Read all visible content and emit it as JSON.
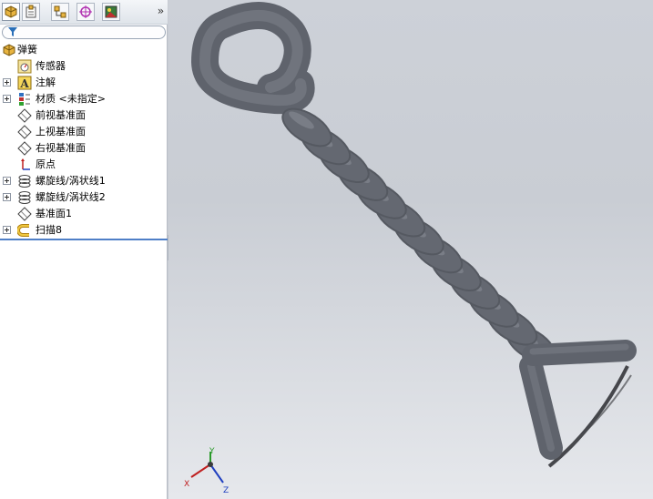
{
  "panel": {
    "expand_glyph": "»",
    "tabs": [
      {
        "icon": "feature-manager-icon"
      },
      {
        "icon": "property-manager-icon"
      },
      {
        "icon": "configuration-manager-icon"
      },
      {
        "icon": "dimxpert-manager-icon"
      },
      {
        "icon": "display-manager-icon"
      }
    ],
    "filter_icon": "filter-icon"
  },
  "tree": {
    "root": {
      "label": "弹簧",
      "icon": "part-icon"
    },
    "items": [
      {
        "label": "传感器",
        "icon": "sensor-icon",
        "expandable": false
      },
      {
        "label": "注解",
        "icon": "annotation-icon",
        "expandable": true
      },
      {
        "label": "材质 <未指定>",
        "icon": "material-icon",
        "expandable": true
      },
      {
        "label": "前视基准面",
        "icon": "plane-icon",
        "expandable": false
      },
      {
        "label": "上视基准面",
        "icon": "plane-icon",
        "expandable": false
      },
      {
        "label": "右视基准面",
        "icon": "plane-icon",
        "expandable": false
      },
      {
        "label": "原点",
        "icon": "origin-icon",
        "expandable": false
      },
      {
        "label": "螺旋线/涡状线1",
        "icon": "helix-icon",
        "expandable": true
      },
      {
        "label": "螺旋线/涡状线2",
        "icon": "helix-icon",
        "expandable": true
      },
      {
        "label": "基准面1",
        "icon": "plane-icon",
        "expandable": false
      },
      {
        "label": "扫描8",
        "icon": "sweep-icon",
        "expandable": true
      }
    ]
  },
  "triad": {
    "x_label": "X",
    "y_label": "Y",
    "z_label": "Z"
  },
  "colors": {
    "model": "#6b6f78",
    "viewport_top": "#cdd1d8",
    "viewport_bottom": "#e6e8ec",
    "selection": "#4f7fc7"
  }
}
